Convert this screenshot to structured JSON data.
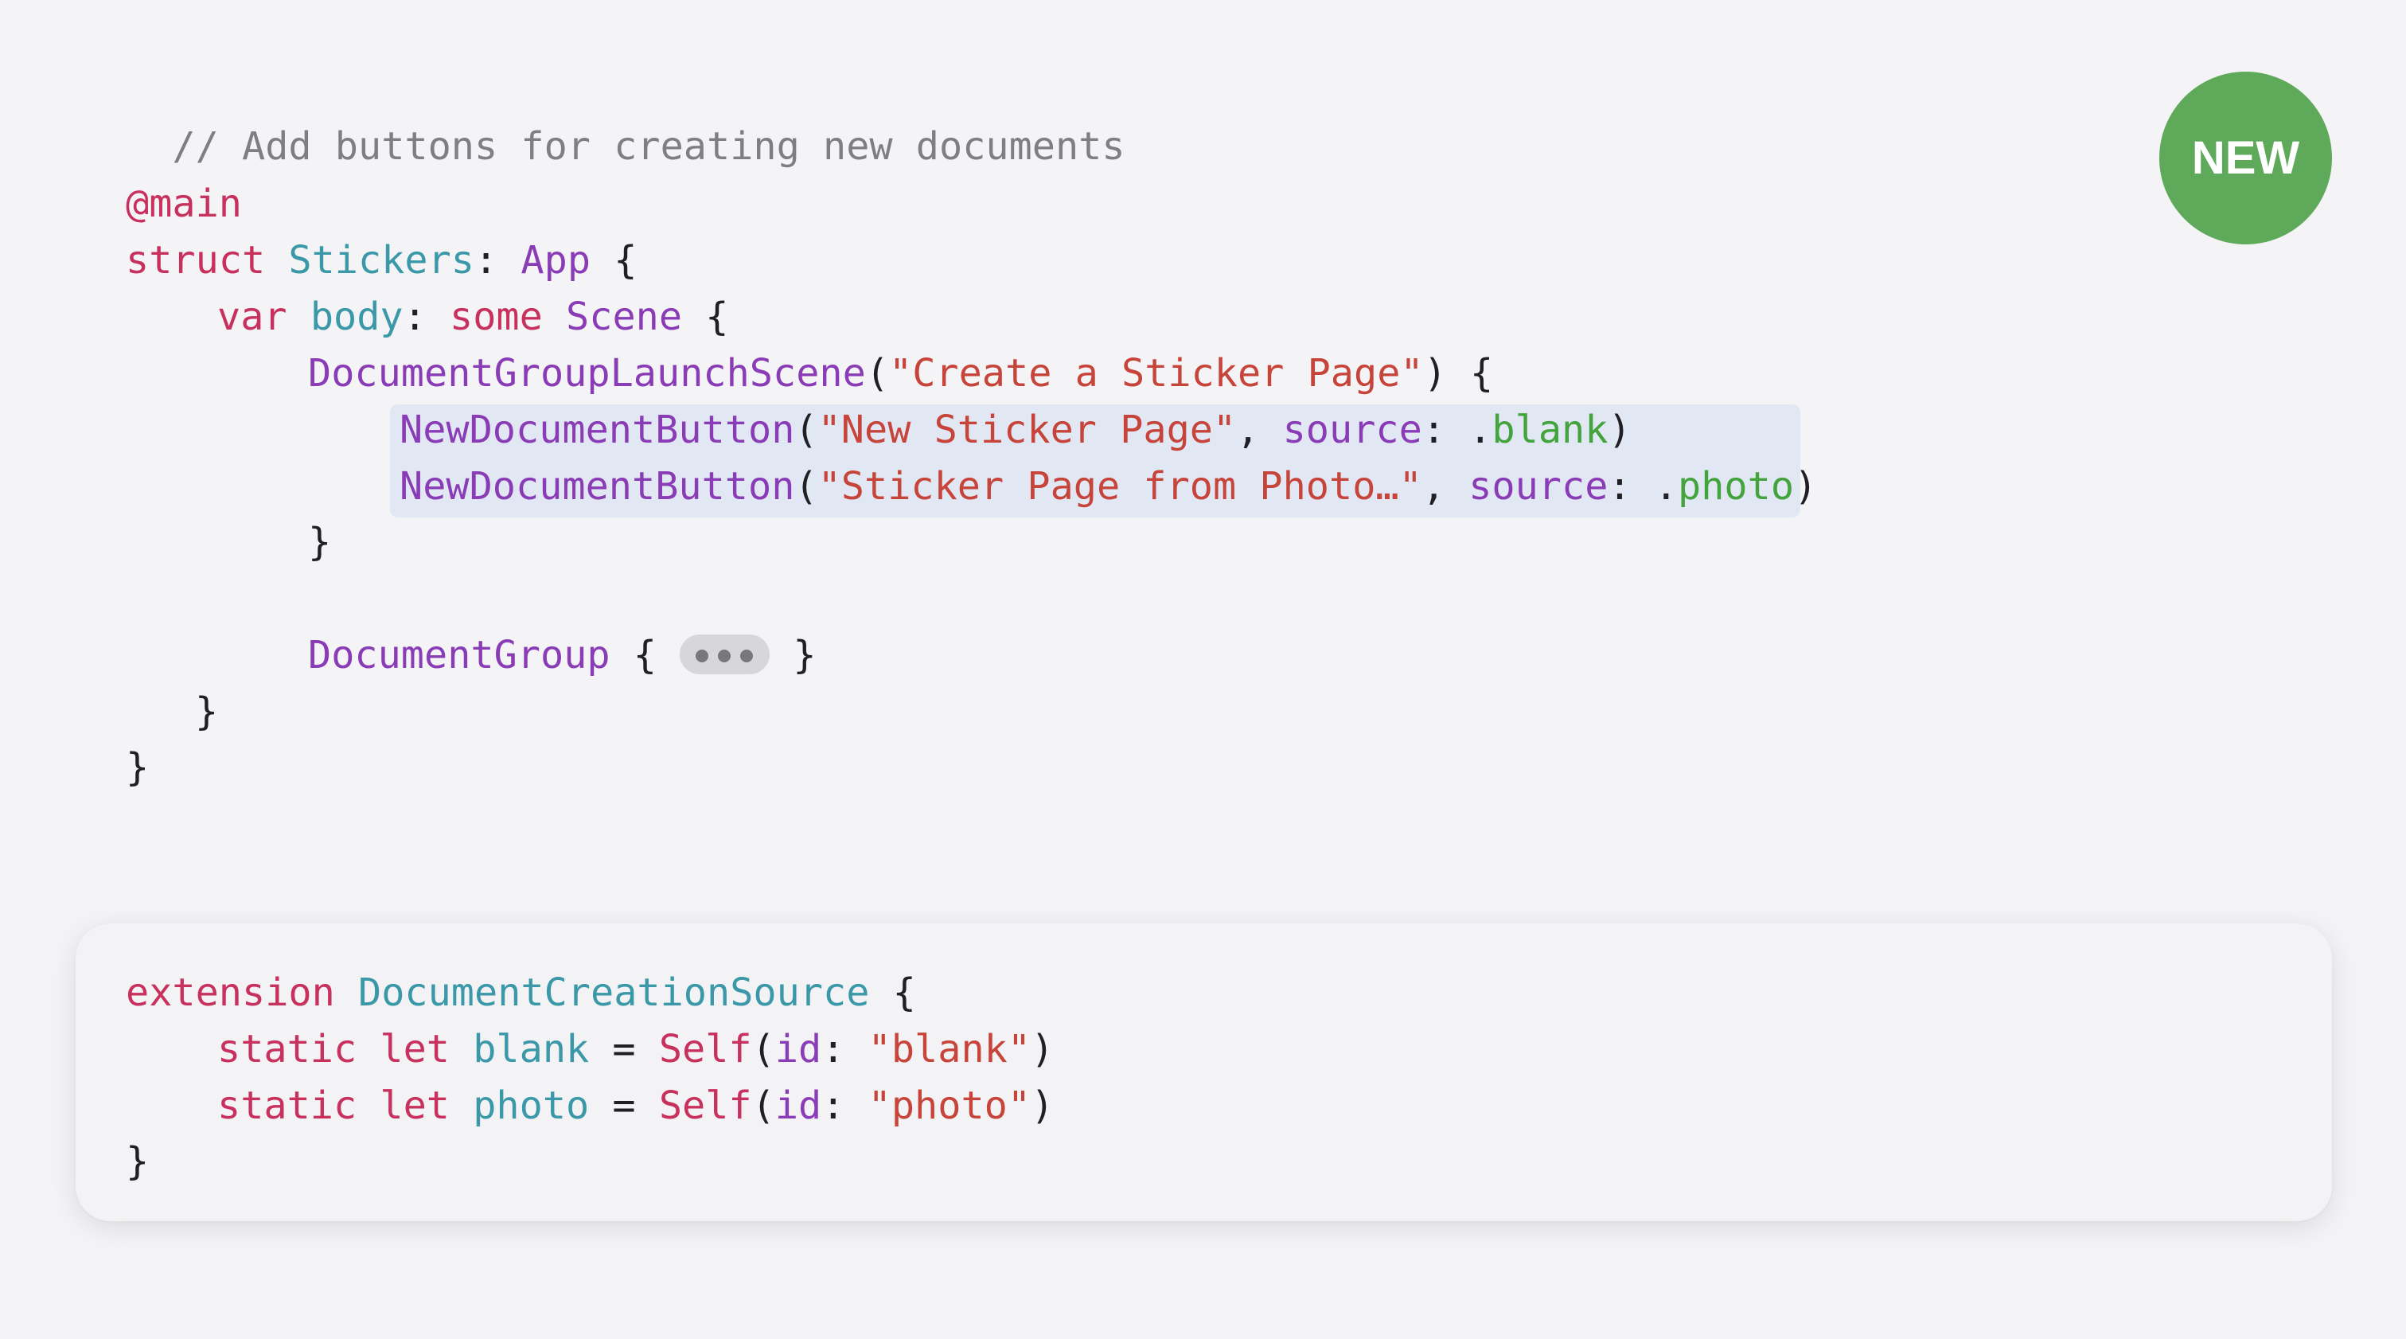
{
  "badge": {
    "label": "NEW",
    "color": "#5fa95a"
  },
  "colors": {
    "background": "#f4f4f6",
    "comment": "#7e7e84",
    "keyword": "#c8305e",
    "type": "#3a98a8",
    "function": "#8a3bb6",
    "string": "#c7443a",
    "enum_case": "#43a33d",
    "highlight": "#e2e7f4"
  },
  "code": {
    "comment": "// Add buttons for creating new documents",
    "attribute": "@main",
    "struct_kw": "struct",
    "struct_name": "Stickers",
    "app_type": "App",
    "var_kw": "var",
    "body_name": "body",
    "some_kw": "some",
    "scene_type": "Scene",
    "launch_scene": "DocumentGroupLaunchScene",
    "launch_title": "\"Create a Sticker Page\"",
    "new_doc_button": "NewDocumentButton",
    "button1_title": "\"New Sticker Page\"",
    "source_label": "source",
    "button1_source": "blank",
    "button2_title": "\"Sticker Page from Photo…\"",
    "button2_source": "photo",
    "document_group": "DocumentGroup",
    "folded_icon": "ellipsis-fold-icon"
  },
  "extension": {
    "ext_kw": "extension",
    "ext_type": "DocumentCreationSource",
    "static_kw": "static",
    "let_kw": "let",
    "prop1": "blank",
    "self_kw": "Self",
    "id_label": "id",
    "prop1_value": "\"blank\"",
    "prop2": "photo",
    "prop2_value": "\"photo\""
  }
}
